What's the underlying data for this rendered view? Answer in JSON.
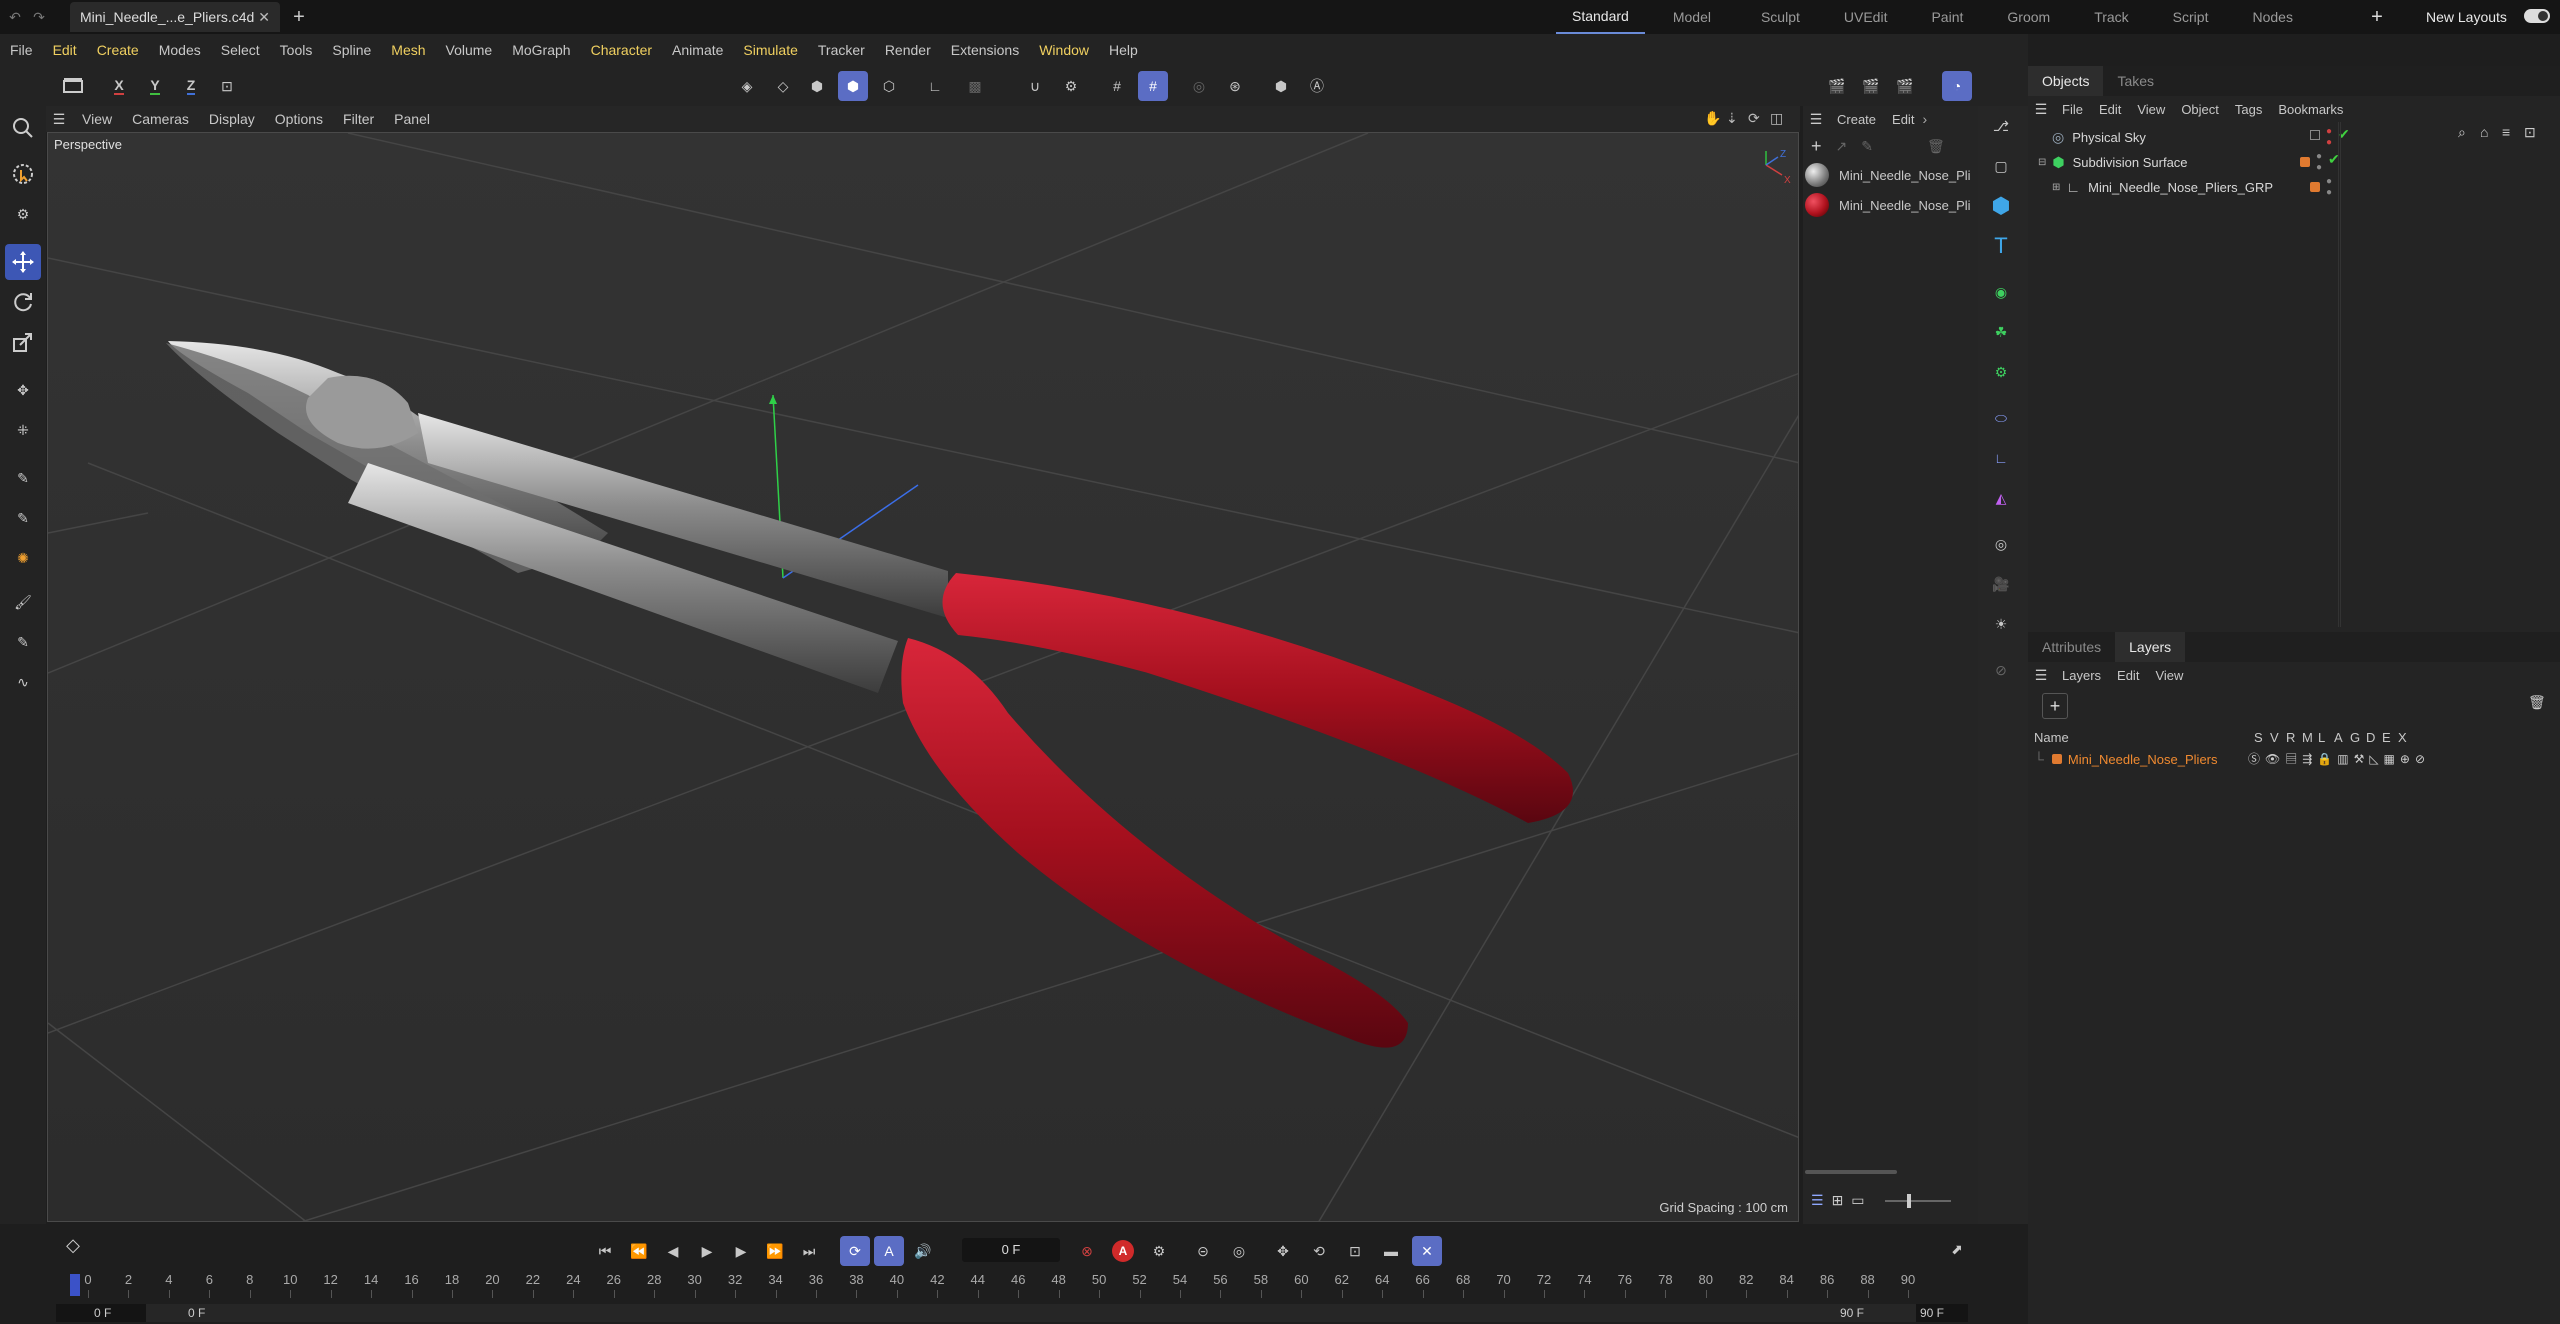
{
  "file_tab": {
    "name": "Mini_Needle_...e_Pliers.c4d"
  },
  "layouts": {
    "tabs": [
      "Standard",
      "Model",
      "Sculpt",
      "UVEdit",
      "Paint",
      "Groom",
      "Track",
      "Script",
      "Nodes"
    ],
    "active": "Standard",
    "new_layouts": "New Layouts"
  },
  "menu": [
    "File",
    "Edit",
    "Create",
    "Modes",
    "Select",
    "Tools",
    "Spline",
    "Mesh",
    "Volume",
    "MoGraph",
    "Character",
    "Animate",
    "Simulate",
    "Tracker",
    "Render",
    "Extensions",
    "Window",
    "Help"
  ],
  "axis_lock": {
    "x": "X",
    "y": "Y",
    "z": "Z"
  },
  "viewport": {
    "menu": [
      "View",
      "Cameras",
      "Display",
      "Options",
      "Filter",
      "Panel"
    ],
    "label": "Perspective",
    "grid_spacing": "Grid Spacing : 100 cm"
  },
  "materials": {
    "menu": [
      "Create",
      "Edit"
    ],
    "items": [
      {
        "name": "Mini_Needle_Nose_Pli",
        "swatch": "#a8a8a8"
      },
      {
        "name": "Mini_Needle_Nose_Pli",
        "swatch": "#b0121e"
      }
    ]
  },
  "objects_panel": {
    "tabs": [
      "Objects",
      "Takes"
    ],
    "menu": [
      "File",
      "Edit",
      "View",
      "Object",
      "Tags",
      "Bookmarks"
    ],
    "items": [
      {
        "name": "Physical Sky"
      },
      {
        "name": "Subdivision Surface"
      },
      {
        "name": "Mini_Needle_Nose_Pliers_GRP"
      }
    ]
  },
  "layers_panel": {
    "tabs": [
      "Attributes",
      "Layers"
    ],
    "menu": [
      "Layers",
      "Edit",
      "View"
    ],
    "columns": {
      "name": "Name",
      "flags": [
        "S",
        "V",
        "R",
        "M",
        "L",
        "A",
        "G",
        "D",
        "E",
        "X"
      ]
    },
    "layers": [
      {
        "name": "Mini_Needle_Nose_Pliers",
        "color": "#e07a30"
      }
    ]
  },
  "timeline": {
    "current_frame": "0 F",
    "start": "0 F",
    "start2": "0 F",
    "end": "90 F",
    "end2": "90 F",
    "ticks": [
      "0",
      "2",
      "4",
      "6",
      "8",
      "10",
      "12",
      "14",
      "16",
      "18",
      "20",
      "22",
      "24",
      "26",
      "28",
      "30",
      "32",
      "34",
      "36",
      "38",
      "40",
      "42",
      "44",
      "46",
      "48",
      "50",
      "52",
      "54",
      "56",
      "58",
      "60",
      "62",
      "64",
      "66",
      "68",
      "70",
      "72",
      "74",
      "76",
      "78",
      "80",
      "82",
      "84",
      "86",
      "88",
      "90"
    ]
  },
  "colors": {
    "accent": "#5b6dc4",
    "highlight_menu": "#f0d060",
    "layer_orange": "#e07a30",
    "handle_red": "#b0121e"
  }
}
